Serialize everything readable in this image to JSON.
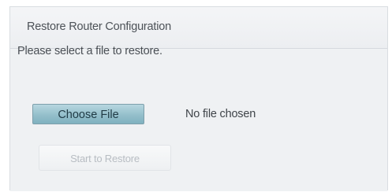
{
  "panel": {
    "title": "Restore Router Configuration"
  },
  "form": {
    "prompt": "Please select a file to restore.",
    "choose_file_label": "Choose File",
    "file_status": "No file chosen",
    "restore_label": "Start to Restore"
  },
  "colors": {
    "choose_file_button": "#94bfcb",
    "panel_background": "#eef0f2",
    "disabled_text": "#b8bdc3"
  }
}
